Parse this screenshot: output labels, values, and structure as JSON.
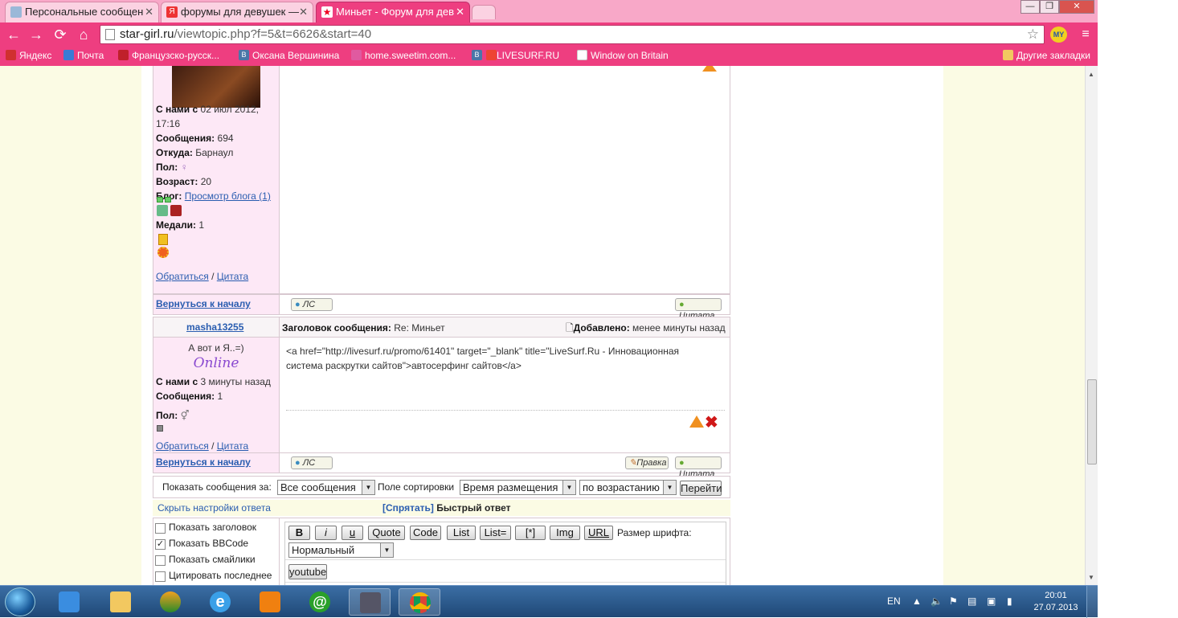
{
  "browser": {
    "tabs": [
      {
        "label": "Персональные сообщен",
        "active": false
      },
      {
        "label": "форумы для девушек —",
        "active": false
      },
      {
        "label": "Миньет - Форум для дев",
        "active": true
      }
    ],
    "url_host": "star-girl.ru",
    "url_path": "/viewtopic.php?f=5&t=6626&start=40",
    "bookmarks": [
      {
        "label": "Яндекс",
        "color": "#d03030"
      },
      {
        "label": "Почта",
        "color": "#3a7bd5"
      },
      {
        "label": "Французско-русск...",
        "color": "#c0202a"
      },
      {
        "label": "Оксана Вершинина",
        "color": "#4a76a8"
      },
      {
        "label": "home.sweetim.com...",
        "color": "#e05aa0"
      },
      {
        "label": "LIVESURF.RU",
        "color": "#4a76a8"
      },
      {
        "label": "Window on Britain",
        "color": "#ffffff"
      }
    ],
    "other_bookmarks": "Другие закладки",
    "profile_badge": "MY",
    "window_controls": {
      "minimize": "—",
      "restore": "❐",
      "close": "✕"
    }
  },
  "post1": {
    "joined_label": "С нами с",
    "joined_value": "02 июл 2012, 17:16",
    "posts_label": "Сообщения:",
    "posts_value": "694",
    "from_label": "Откуда:",
    "from_value": "Барнаул",
    "sex_label": "Пол:",
    "age_label": "Возраст:",
    "age_value": "20",
    "blog_label": "Блог:",
    "blog_link": "Просмотр блога (1)",
    "medals_label": "Медали:",
    "medals_value": "1",
    "contact_link": "Обратиться",
    "quote_link": "Цитата",
    "separator": "/",
    "back_to_top": "Вернуться к началу",
    "pm_button": "ЛС",
    "quote_button": "Цитата"
  },
  "post2": {
    "author": "masha13255",
    "subject_label": "Заголовок сообщения:",
    "subject_value": "Re: Миньет",
    "added_label": "Добавлено:",
    "added_value": "менее минуты назад",
    "status_text": "А вот и Я..=)",
    "online_text": "Online",
    "joined_label": "С нами с",
    "joined_value": "3 минуты назад",
    "posts_label": "Сообщения:",
    "posts_value": "1",
    "sex_label": "Пол:",
    "body_line1": "<a href=\"http://livesurf.ru/promo/61401\" target=\"_blank\" title=\"LiveSurf.Ru - Инновационная",
    "body_line2": "система раскрутки сайтов\">автосерфинг сайтов</a>",
    "contact_link": "Обратиться",
    "quote_link": "Цитата",
    "separator": "/",
    "back_to_top": "Вернуться к началу",
    "pm_button": "ЛС",
    "edit_button": "Правка",
    "quote_button": "Цитата"
  },
  "sort": {
    "show_label": "Показать сообщения за:",
    "show_value": "Все сообщения",
    "field_label": "Поле сортировки",
    "field_value": "Время размещения",
    "order_value": "по возрастанию",
    "go_button": "Перейти"
  },
  "quickreply": {
    "hide_settings": "Скрыть настройки ответа",
    "hide_link": "[Спрятать]",
    "title": "Быстрый ответ",
    "options": [
      {
        "label": "Показать заголовок",
        "checked": false
      },
      {
        "label": "Показать BBCode",
        "checked": true
      },
      {
        "label": "Показать смайлики",
        "checked": false
      },
      {
        "label": "Цитировать последнее",
        "checked": false
      }
    ],
    "bbcode_buttons": [
      "B",
      "i",
      "u",
      "Quote",
      "Code",
      "List",
      "List=",
      "[*]",
      "Img",
      "URL"
    ],
    "font_size_label": "Размер шрифта:",
    "font_size_value": "Нормальный",
    "youtube_button": "youtube"
  },
  "taskbar": {
    "lang": "EN",
    "time": "20:01",
    "date": "27.07.2013"
  }
}
